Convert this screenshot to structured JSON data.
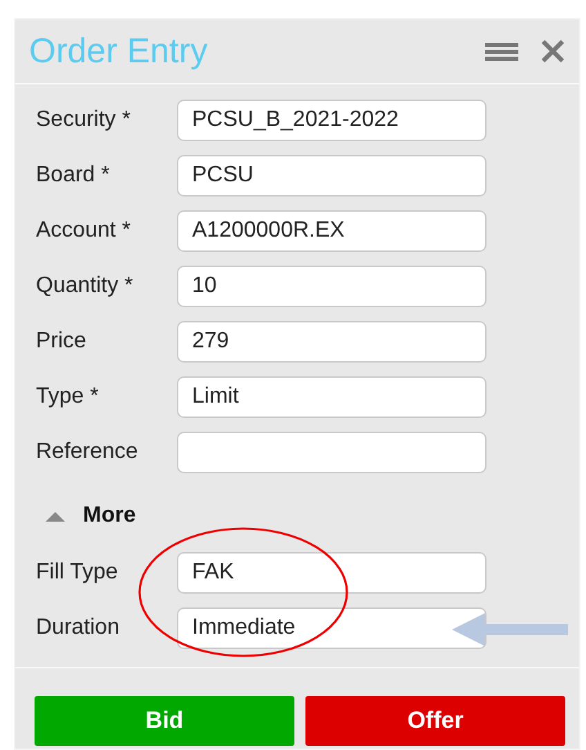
{
  "panel": {
    "title": "Order Entry"
  },
  "fields": [
    {
      "label": "Security *",
      "value": "PCSU_B_2021-2022"
    },
    {
      "label": "Board *",
      "value": "PCSU"
    },
    {
      "label": "Account *",
      "value": "A1200000R.EX"
    },
    {
      "label": "Quantity *",
      "value": "10"
    },
    {
      "label": "Price",
      "value": "279"
    },
    {
      "label": "Type *",
      "value": "Limit"
    },
    {
      "label": "Reference"
    }
  ],
  "more": {
    "label": "More",
    "expanded": true
  },
  "more_fields": [
    {
      "label": "Fill Type",
      "value": "FAK"
    },
    {
      "label": "Duration",
      "value": "Immediate"
    }
  ],
  "buttons": [
    {
      "label": "Bid",
      "kind": "bid"
    },
    {
      "label": "Offer",
      "kind": "offer"
    }
  ]
}
